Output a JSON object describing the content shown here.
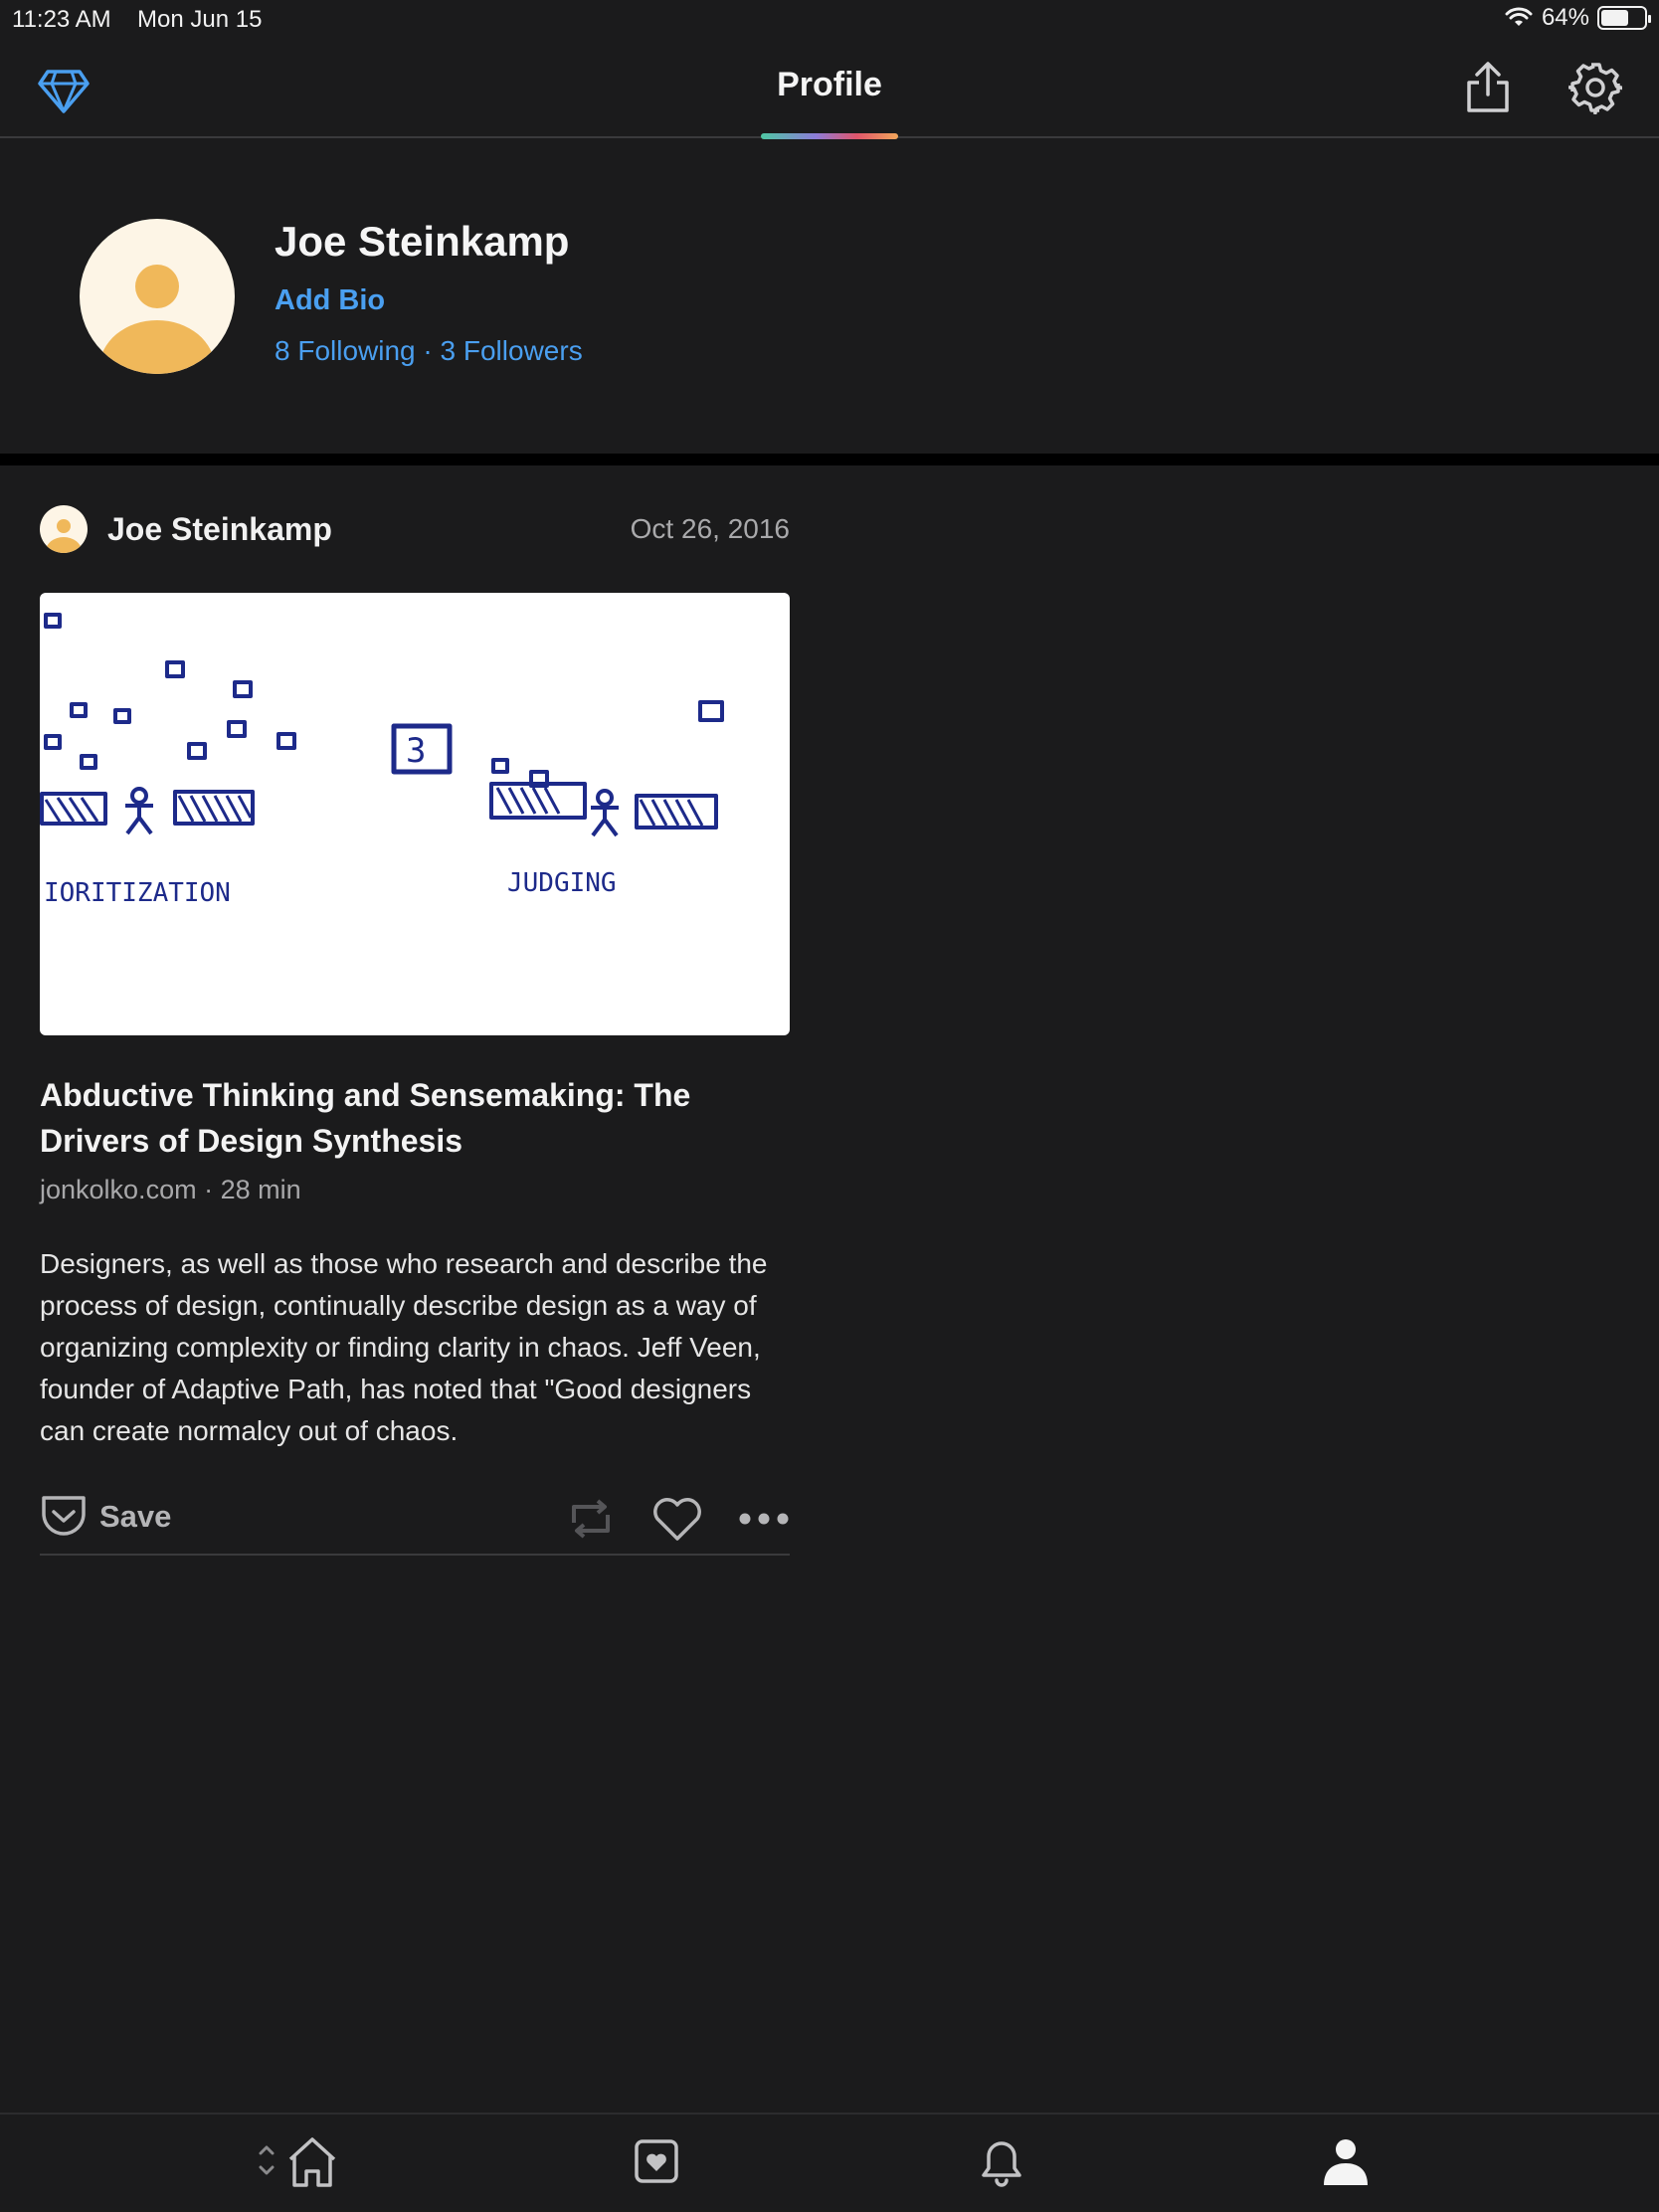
{
  "status_bar": {
    "time": "11:23 AM",
    "date": "Mon Jun 15",
    "battery_text": "64%",
    "battery_level": 0.64
  },
  "nav": {
    "title": "Profile",
    "accent_colors": [
      "#4ec7a3",
      "#8d7cd8",
      "#e0566b",
      "#f2a65a"
    ]
  },
  "profile": {
    "name": "Joe Steinkamp",
    "add_bio_label": "Add Bio",
    "following_label": "8 Following",
    "separator": "·",
    "followers_label": "3 Followers",
    "link_color": "#4a9ff0"
  },
  "post": {
    "author": "Joe Steinkamp",
    "date": "Oct 26, 2016",
    "image_labels": [
      "IORITIZATION",
      "JUDGING"
    ],
    "image_box_number": "3",
    "title": "Abductive Thinking and Sensemaking: The Drivers of Design Synthesis",
    "meta": "jonkolko.com · 28 min",
    "excerpt": "Designers, as well as those who research and describe the process of design, continually describe design as a way of organizing complexity or finding clarity in chaos. Jeff Veen, founder of Adaptive Path, has noted that \"Good designers can create normalcy out of chaos.",
    "save_label": "Save"
  },
  "icons": {
    "top_left": "diamond-icon",
    "share": "share-icon",
    "settings": "gear-icon",
    "repost": "repost-icon",
    "like": "heart-icon",
    "more": "more-icon",
    "tabs": [
      "home-icon",
      "saved-icon",
      "bell-icon",
      "person-icon"
    ]
  },
  "colors": {
    "background": "#1b1b1c",
    "avatar_bg": "#fdf5e6",
    "avatar_figure": "#f0b85a"
  }
}
